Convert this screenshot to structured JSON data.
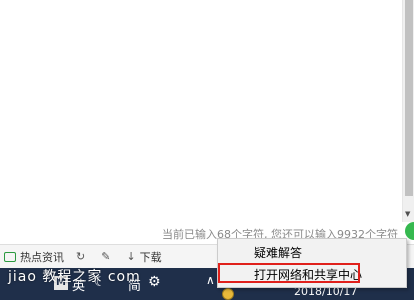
{
  "editor": {
    "counter_text": "当前已输入68个字符, 您还可以输入9932个字符"
  },
  "statusbar": {
    "hot_news_label": "热点资讯",
    "download_label": "下载"
  },
  "taskbar": {
    "ime_label": "英",
    "ime_mode": "简",
    "date": "2018/10/17",
    "ime_badge": "M"
  },
  "context_menu": {
    "items": [
      {
        "label": "疑难解答"
      },
      {
        "label": "打开网络和共享中心"
      }
    ]
  },
  "watermark": {
    "text": "jiao 教程之家 com"
  },
  "colors": {
    "taskbar_bg": "#1f2f4a",
    "highlight_border": "#e0201b",
    "accent_green": "#35b84f"
  }
}
